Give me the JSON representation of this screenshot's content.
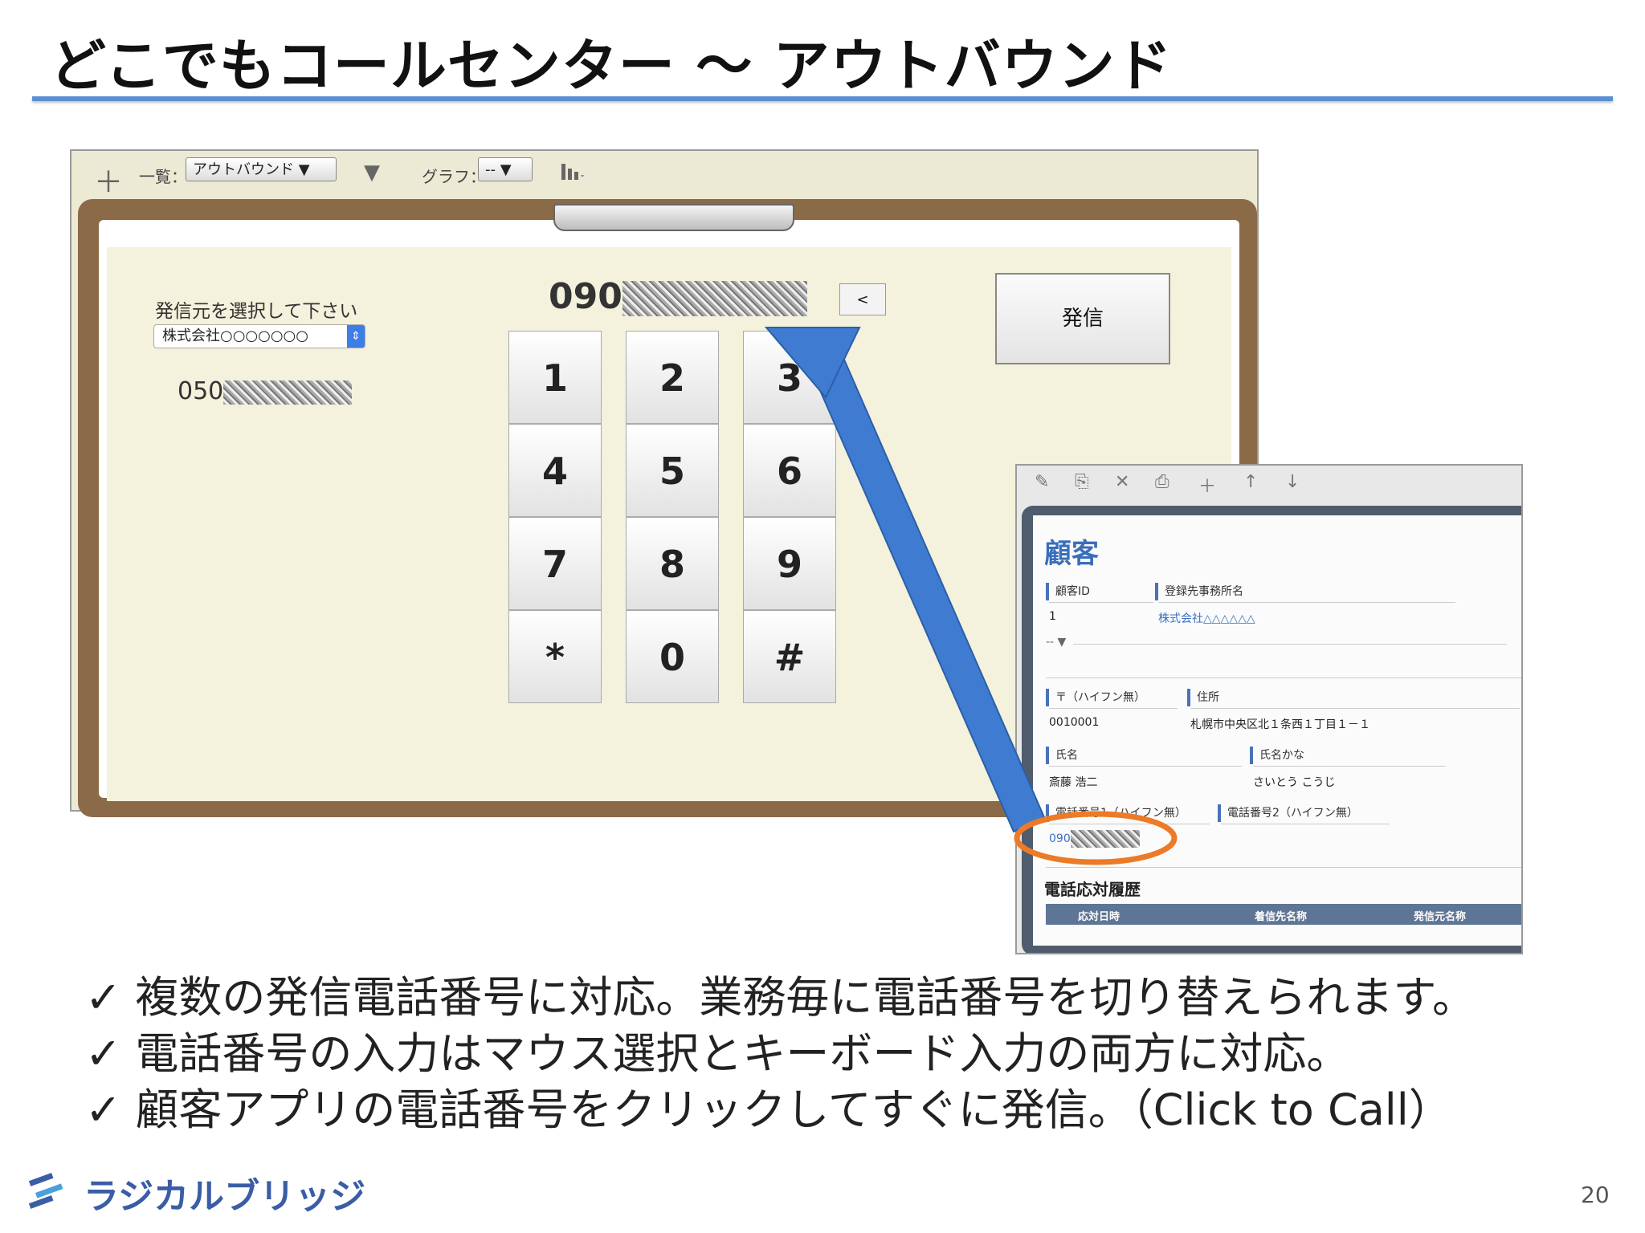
{
  "slide": {
    "title": "どこでもコールセンター ～ アウトバウンド",
    "bullets": [
      "✓ 複数の発信電話番号に対応。業務毎に電話番号を切り替えられます。",
      "✓ 電話番号の入力はマウス選択とキーボード入力の両方に対応。",
      "✓ 顧客アプリの電話番号をクリックしてすぐに発信。（Click to Call）"
    ],
    "logo_text": "ラジカルブリッジ",
    "page_number": "20"
  },
  "app": {
    "toolbar": {
      "add_icon": "＋",
      "list_label": "一覧：",
      "list_value": "アウトバウンド ▼",
      "filter_icon": "▼",
      "graph_label": "グラフ：",
      "graph_value": "-- ▼",
      "chart_icon": "📊"
    },
    "source_label": "発信元を選択して下さい",
    "source_value": "株式会社○○○○○○○",
    "source_number_prefix": "050",
    "dial_prefix": "090",
    "back_label": "<",
    "call_label": "発信",
    "keys": [
      "1",
      "2",
      "3",
      "4",
      "5",
      "6",
      "7",
      "8",
      "9",
      "*",
      "0",
      "#"
    ]
  },
  "customer": {
    "title": "顧客",
    "fields": {
      "id_label": "顧客ID",
      "id_value": "1",
      "office_label": "登録先事務所名",
      "office_value": "株式会社△△△△△△",
      "dash": "-- ▼",
      "zip_label": "〒（ハイフン無）",
      "zip_value": "0010001",
      "address_label": "住所",
      "address_value": "札幌市中央区北１条西１丁目１－１",
      "name_label": "氏名",
      "name_value": "斎藤 浩二",
      "kana_label": "氏名かな",
      "kana_value": "さいとう こうじ",
      "phone1_label": "電話番号1（ハイフン無）",
      "phone1_prefix": "090",
      "phone2_label": "電話番号2（ハイフン無）"
    },
    "history_title": "電話応対履歴",
    "history_columns": [
      "応対日時",
      "着信先名称",
      "発信元名称"
    ]
  },
  "colors": {
    "title_rule": "#5b8ed2",
    "arrow": "#3f7bd0",
    "highlight_ellipse": "#ec7a26",
    "customer_title": "#3a6ebb"
  }
}
